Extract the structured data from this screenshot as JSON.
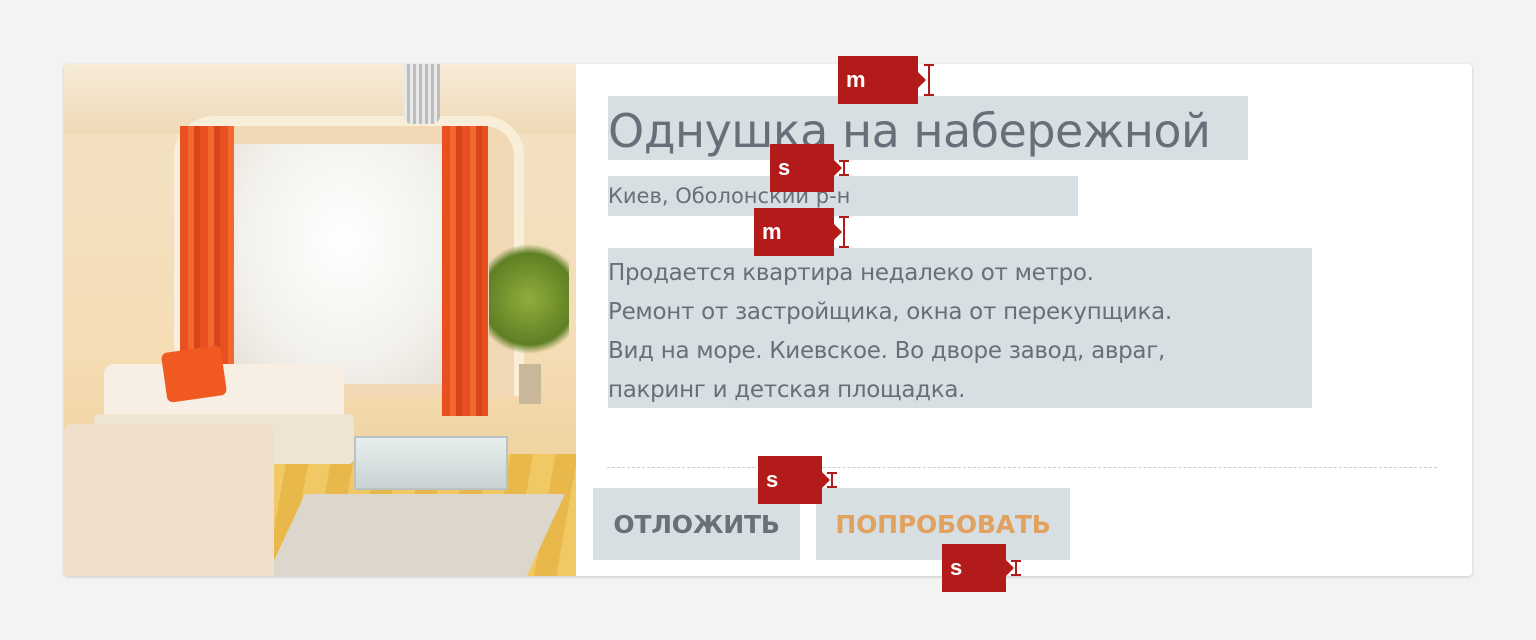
{
  "listing": {
    "photo_icon": "living-room-photo",
    "title": "Однушка на набережной",
    "location": "Киев, Оболонский р-н",
    "description_lines": [
      "Продается квартира недалеко от метро.",
      "Ремонт от застройщика, окна от перекупщика.",
      "Вид на море. Киевское. Во дворе завод, авраг,",
      "пакринг и детская площадка."
    ]
  },
  "actions": {
    "postpone_label": "ОТЛОЖИТЬ",
    "try_label": "ПОПРОБОВАТЬ"
  },
  "spacing_markers": {
    "top_padding": "m",
    "title_to_location": "s",
    "location_to_description": "m",
    "divider_to_buttons": "s",
    "bottom_padding": "s"
  },
  "colors": {
    "page_background": "#f3f3f3",
    "card_background": "#ffffff",
    "highlight": "#d8dfe2",
    "text": "#66707a",
    "accent": "#e0a25e",
    "marker": "#b31b1b"
  }
}
